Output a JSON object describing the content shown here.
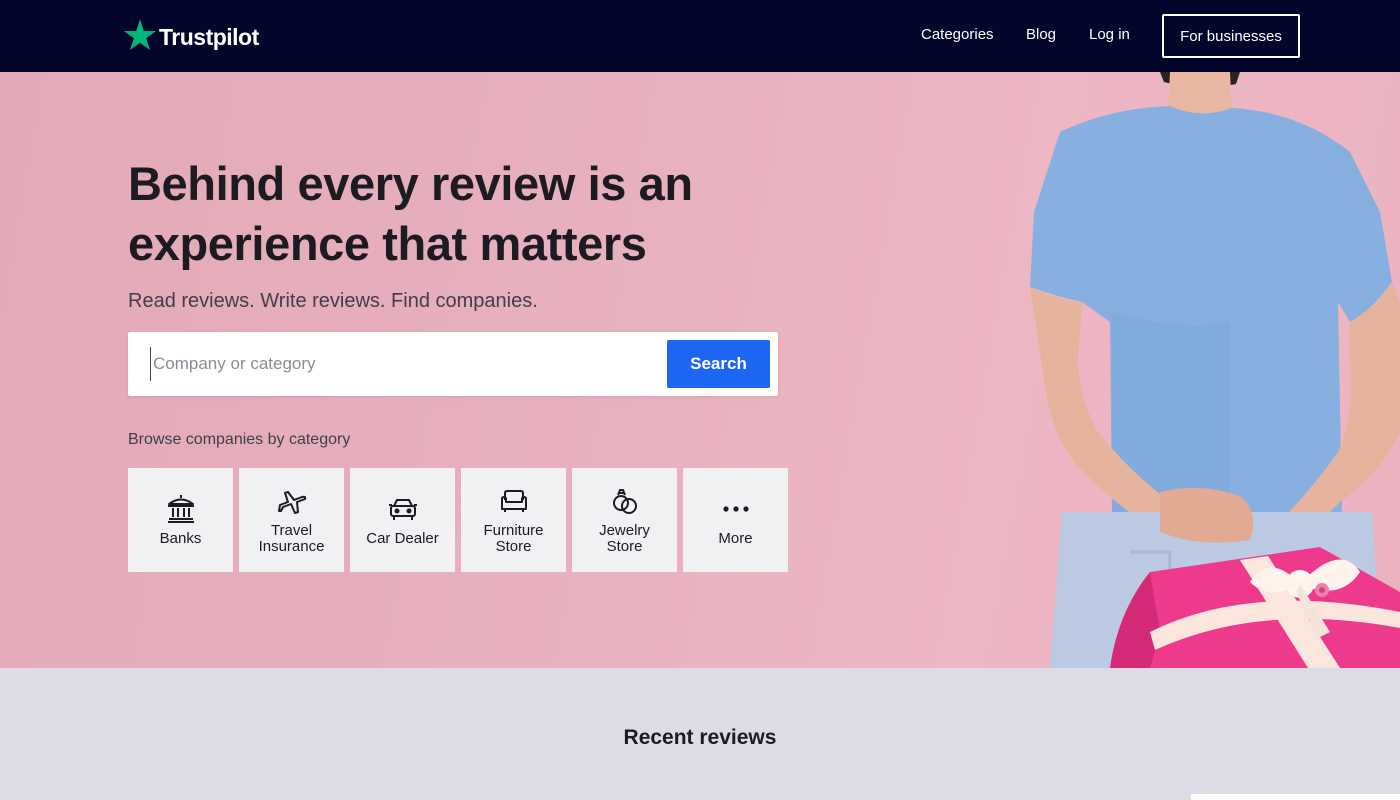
{
  "nav": {
    "brand": "Trustpilot",
    "links": [
      {
        "label": "Categories"
      },
      {
        "label": "Blog"
      },
      {
        "label": "Log in"
      }
    ],
    "cta_label": "For businesses"
  },
  "hero": {
    "title": "Behind every review is an experience that matters",
    "subtitle": "Read reviews. Write reviews. Find companies.",
    "search": {
      "placeholder": "Company or category",
      "value": "",
      "button_label": "Search"
    },
    "browse_label": "Browse companies by category",
    "categories": [
      {
        "label": "Banks",
        "icon": "bank-icon"
      },
      {
        "label": "Travel\nInsurance",
        "icon": "airplane-icon"
      },
      {
        "label": "Car Dealer",
        "icon": "car-icon"
      },
      {
        "label": "Furniture\nStore",
        "icon": "sofa-icon"
      },
      {
        "label": "Jewelry\nStore",
        "icon": "rings-icon"
      },
      {
        "label": "More",
        "icon": "more-dots-icon"
      }
    ]
  },
  "recent": {
    "title": "Recent reviews"
  },
  "colors": {
    "nav_bg": "#04052b",
    "accent_green": "#00b67a",
    "search_button": "#1c66f2",
    "hero_bg": "#e8b1bf",
    "section_bg": "#dcdce6"
  }
}
